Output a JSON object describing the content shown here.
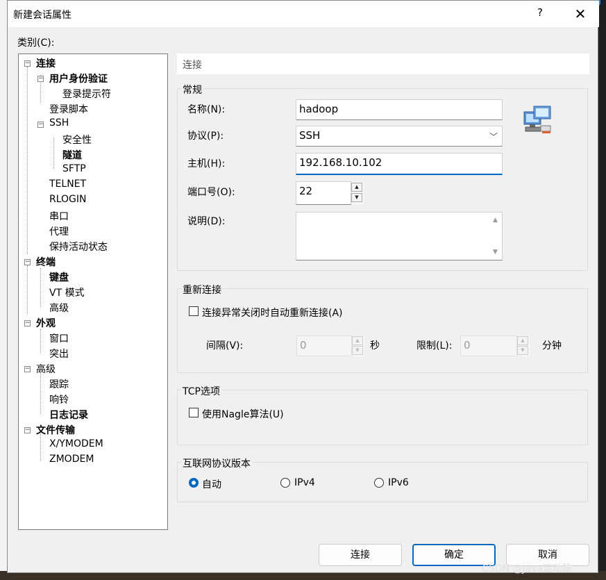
{
  "window": {
    "title": "新建会话属性",
    "help": "?",
    "close": "✕"
  },
  "category_label": "类别(C):",
  "tree": [
    {
      "label": "连接",
      "bold": true
    },
    {
      "label": "用户身份验证",
      "bold": true
    },
    {
      "label": "登录提示符",
      "bold": false
    },
    {
      "label": "登录脚本",
      "bold": false
    },
    {
      "label": "SSH",
      "bold": false
    },
    {
      "label": "安全性",
      "bold": false
    },
    {
      "label": "隧道",
      "bold": true
    },
    {
      "label": "SFTP",
      "bold": false
    },
    {
      "label": "TELNET",
      "bold": false
    },
    {
      "label": "RLOGIN",
      "bold": false
    },
    {
      "label": "串口",
      "bold": false
    },
    {
      "label": "代理",
      "bold": false
    },
    {
      "label": "保持活动状态",
      "bold": false
    },
    {
      "label": "终端",
      "bold": true
    },
    {
      "label": "键盘",
      "bold": true
    },
    {
      "label": "VT 模式",
      "bold": false
    },
    {
      "label": "高级",
      "bold": false
    },
    {
      "label": "外观",
      "bold": true
    },
    {
      "label": "窗口",
      "bold": false
    },
    {
      "label": "突出",
      "bold": false
    },
    {
      "label": "高级",
      "bold": false
    },
    {
      "label": "跟踪",
      "bold": false
    },
    {
      "label": "响铃",
      "bold": false
    },
    {
      "label": "日志记录",
      "bold": true
    },
    {
      "label": "文件传输",
      "bold": true
    },
    {
      "label": "X/YMODEM",
      "bold": false
    },
    {
      "label": "ZMODEM",
      "bold": false
    }
  ],
  "panel_header": "连接",
  "general": {
    "title": "常规",
    "name_label": "名称(N):",
    "name_value": "hadoop",
    "protocol_label": "协议(P):",
    "protocol_value": "SSH",
    "host_label": "主机(H):",
    "host_value": "192.168.10.102",
    "port_label": "端口号(O):",
    "port_value": "22",
    "desc_label": "说明(D):"
  },
  "reconnect": {
    "title": "重新连接",
    "checkbox_label": "连接异常关闭时自动重新连接(A)",
    "interval_label": "间隔(V):",
    "interval_value": "0",
    "interval_unit": "秒",
    "limit_label": "限制(L):",
    "limit_value": "0",
    "limit_unit": "分钟"
  },
  "tcp": {
    "title": "TCP选项",
    "nagle_label": "使用Nagle算法(U)"
  },
  "ipver": {
    "title": "互联网协议版本",
    "options": [
      "自动",
      "IPv4",
      "IPv6"
    ],
    "selected": "自动"
  },
  "buttons": {
    "connect": "连接",
    "ok": "确定",
    "cancel": "取消"
  },
  "watermark": "CSDN @Java运动猿",
  "colors": {
    "accent": "#0067c0"
  }
}
